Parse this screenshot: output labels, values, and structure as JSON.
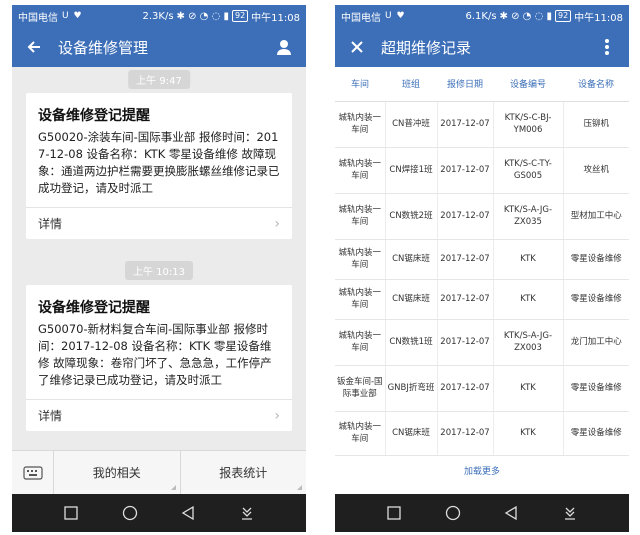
{
  "status": {
    "carrier": "中国电信",
    "left_speed": "2.3K/s",
    "right_speed": "6.1K/s",
    "battery": "92",
    "time": "中午11:08"
  },
  "left": {
    "title": "设备维修管理",
    "messages": [
      {
        "time": "上午 9:47",
        "title": "设备维修登记提醒",
        "body": "G50020-涂装车间-国际事业部 报修时间：2017-12-08 设备名称：KTK 零星设备维修 故障现象：通道两边护栏需要更换膨胀螺丝维修记录已成功登记，请及时派工",
        "detail": "详情"
      },
      {
        "time": "上午 10:13",
        "title": "设备维修登记提醒",
        "body": "G50070-新材料复合车间-国际事业部 报修时间：2017-12-08 设备名称：KTK 零星设备维修 故障现象：卷帘门坏了、急急急，工作停产了维修记录已成功登记，请及时派工",
        "detail": "详情"
      }
    ],
    "menu": [
      "我的相关",
      "报表统计"
    ]
  },
  "right": {
    "title": "超期维修记录",
    "columns": [
      "车间",
      "班组",
      "报修日期",
      "设备编号",
      "设备名称"
    ],
    "rows": [
      [
        "城轨内装一车间",
        "CN普冲班",
        "2017-12-07",
        "KTK/S-C-BJ-YM006",
        "压铆机"
      ],
      [
        "城轨内装一车间",
        "CN焊接1班",
        "2017-12-07",
        "KTK/S-C-TY-GS005",
        "攻丝机"
      ],
      [
        "城轨内装一车间",
        "CN数铣2班",
        "2017-12-07",
        "KTK/S-A-JG-ZX035",
        "型材加工中心"
      ],
      [
        "城轨内装一车间",
        "CN锯床班",
        "2017-12-07",
        "KTK",
        "零星设备维修"
      ],
      [
        "城轨内装一车间",
        "CN锯床班",
        "2017-12-07",
        "KTK",
        "零星设备维修"
      ],
      [
        "城轨内装一车间",
        "CN数铣1班",
        "2017-12-07",
        "KTK/S-A-JG-ZX003",
        "龙门加工中心"
      ],
      [
        "钣金车间-国际事业部",
        "GNBJ折弯班",
        "2017-12-07",
        "KTK",
        "零星设备维修"
      ],
      [
        "城轨内装一车间",
        "CN锯床班",
        "2017-12-07",
        "KTK",
        "零星设备维修"
      ]
    ],
    "load_more": "加载更多"
  }
}
